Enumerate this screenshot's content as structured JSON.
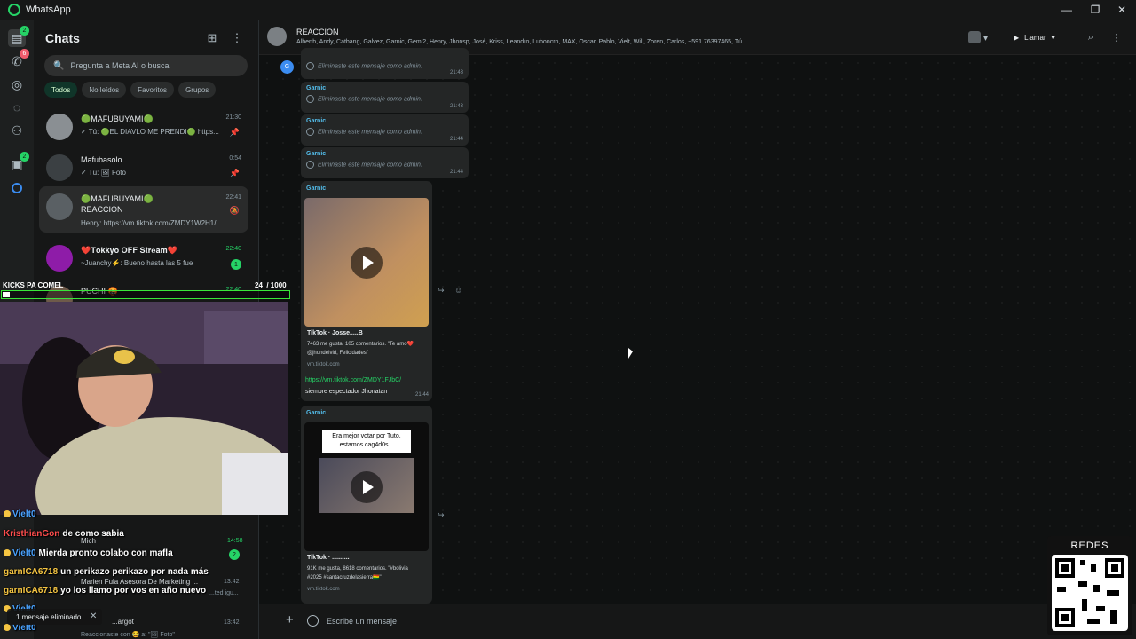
{
  "window": {
    "title": "WhatsApp"
  },
  "rail": {
    "chats_badge": "2",
    "calls_badge": "6",
    "communities_badge": "2"
  },
  "panel": {
    "title": "Chats",
    "search_placeholder": "Pregunta a Meta AI o busca",
    "filters": [
      "Todos",
      "No leídos",
      "Favoritos",
      "Grupos"
    ]
  },
  "chat_list": [
    {
      "name": "🟢MAFUBUYAMI🟢",
      "time": "21:30",
      "preview": "✓ Tú: 🟢EL DIAVLO ME PRENDI🟢 https..."
    },
    {
      "name": "Mafubasolo",
      "time": "0:54",
      "preview": "✓ Tú: 🖼 Foto"
    },
    {
      "name": "🟢MAFUBUYAMI🟢",
      "time": "22:41",
      "subtitle": "REACCION",
      "preview": "Henry: https://vm.tiktok.com/ZMDY1W2H1/"
    },
    {
      "name": "❤️𝐓𝐨𝐤𝐤𝐲𝐨 𝐎𝐅𝐅 𝐒𝐭𝐫𝐞𝐚𝐦❤️",
      "time": "22:40",
      "preview": "~Juanchy⚡: Bueno hasta las 5 fue",
      "unread": "1"
    },
    {
      "name": "PUCHI 🤬",
      "time": "22:40",
      "preview": ""
    }
  ],
  "chat": {
    "name": "REACCION",
    "members": "Alberth, Andy, Catbang, Galvez, Garnic, Gemi2, Henry, Jhonsp, José, Kriss, Leandro, Luboncro, MAX, Oscar, Pablo, Vielt, Will, Zoren,     Carlos, +591 76397465, Tú",
    "call_label": "Llamar",
    "composer_placeholder": "Escribe un mensaje"
  },
  "messages": [
    {
      "sender": "Garnic",
      "text": "Eliminaste este mensaje como admin.",
      "time": "21:43"
    },
    {
      "sender": "Garnic",
      "text": "Eliminaste este mensaje como admin.",
      "time": "21:43"
    },
    {
      "sender": "Garnic",
      "text": "Eliminaste este mensaje como admin.",
      "time": "21:44"
    },
    {
      "sender": "Garnic",
      "text": "Eliminaste este mensaje como admin.",
      "time": "21:44"
    }
  ],
  "media_messages": [
    {
      "sender": "Garnic",
      "preview_title": "TikTok · Josse.....B",
      "preview_desc": "7463 me gusta, 105 comentarios. \"Te amo❤️@jhondeivid, Felicidades\"",
      "domain": "vm.tiktok.com",
      "link": "https://vm.tiktok.com/ZMDY1FJbC/",
      "text": "siempre espectador Jhonatan",
      "time": "21:44"
    },
    {
      "sender": "Garnic",
      "thumb_caption": "Era mejor votar por Tuto, estamos cag4d0s...",
      "preview_title": "TikTok · ..........",
      "preview_desc": "91K me gusta, 8618 comentarios. \"#bolivia #2025 #santacruzdelasierra🇧🇴\"",
      "domain": "vm.tiktok.com"
    }
  ],
  "overlay": {
    "goal_label": "KICKS PA COMEL",
    "goal_count": "24",
    "goal_total": "/ 1000",
    "goal_progress": 0.024
  },
  "stream_chat": [
    {
      "user": "Vielt0",
      "text": "",
      "user_color": "#4aa3ff"
    },
    {
      "user": "KristhianGon",
      "text": "de como sabia",
      "user_color": "#ff4d4d"
    },
    {
      "user": "Vielt0",
      "text": "Mierda pronto colabo con mafla",
      "user_color": "#4aa3ff"
    },
    {
      "user": "garnICA6718",
      "text": "un perikazo perikazo por nada más",
      "user_color": "#f5c542"
    },
    {
      "user": "garnICA6718",
      "text": "yo los llamo por vos en año nuevo",
      "user_color": "#f5c542"
    },
    {
      "user": "Vielt0",
      "text": "",
      "user_color": "#4aa3ff"
    },
    {
      "user": "Vielt0",
      "text": "",
      "user_color": "#4aa3ff"
    }
  ],
  "underlay_chats": [
    {
      "name": "Mich",
      "time": "14:58",
      "unread": "2"
    },
    {
      "name": "Marien Fula Asesora De Marketing ...",
      "time": "13:42",
      "preview": "...ted igu..."
    },
    {
      "name": "...argot",
      "time": "13:42",
      "preview": "Reaccionaste con 😂 a: \"🖼 Foto\""
    }
  ],
  "toast": {
    "text": "1 mensaje eliminado"
  },
  "qr": {
    "label": "REDES"
  }
}
